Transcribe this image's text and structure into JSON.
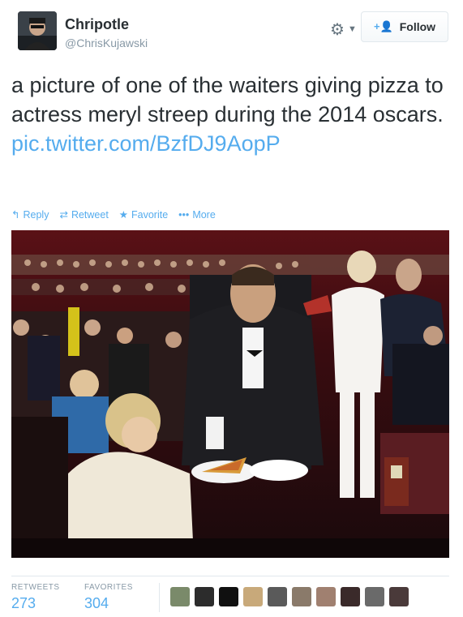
{
  "user": {
    "display_name": "Chripotle",
    "screen_name": "@ChrisKujawski"
  },
  "follow_button": {
    "label": "Follow"
  },
  "tweet": {
    "text": "a picture of one of the waiters giving pizza to actress meryl streep during the 2014 oscars.",
    "link": "pic.twitter.com/BzfDJ9AopP"
  },
  "actions": {
    "reply": "Reply",
    "retweet": "Retweet",
    "favorite": "Favorite",
    "more": "More"
  },
  "stats": {
    "retweets_label": "RETWEETS",
    "retweets": "273",
    "favorites_label": "FAVORITES",
    "favorites": "304"
  },
  "colors": {
    "link": "#55acee",
    "text": "#292f33",
    "muted": "#8899a6"
  },
  "icons": [
    "gear-icon",
    "chevron-down-icon",
    "follow-add-icon",
    "reply-icon",
    "retweet-icon",
    "favorite-star-icon",
    "more-dots-icon"
  ]
}
